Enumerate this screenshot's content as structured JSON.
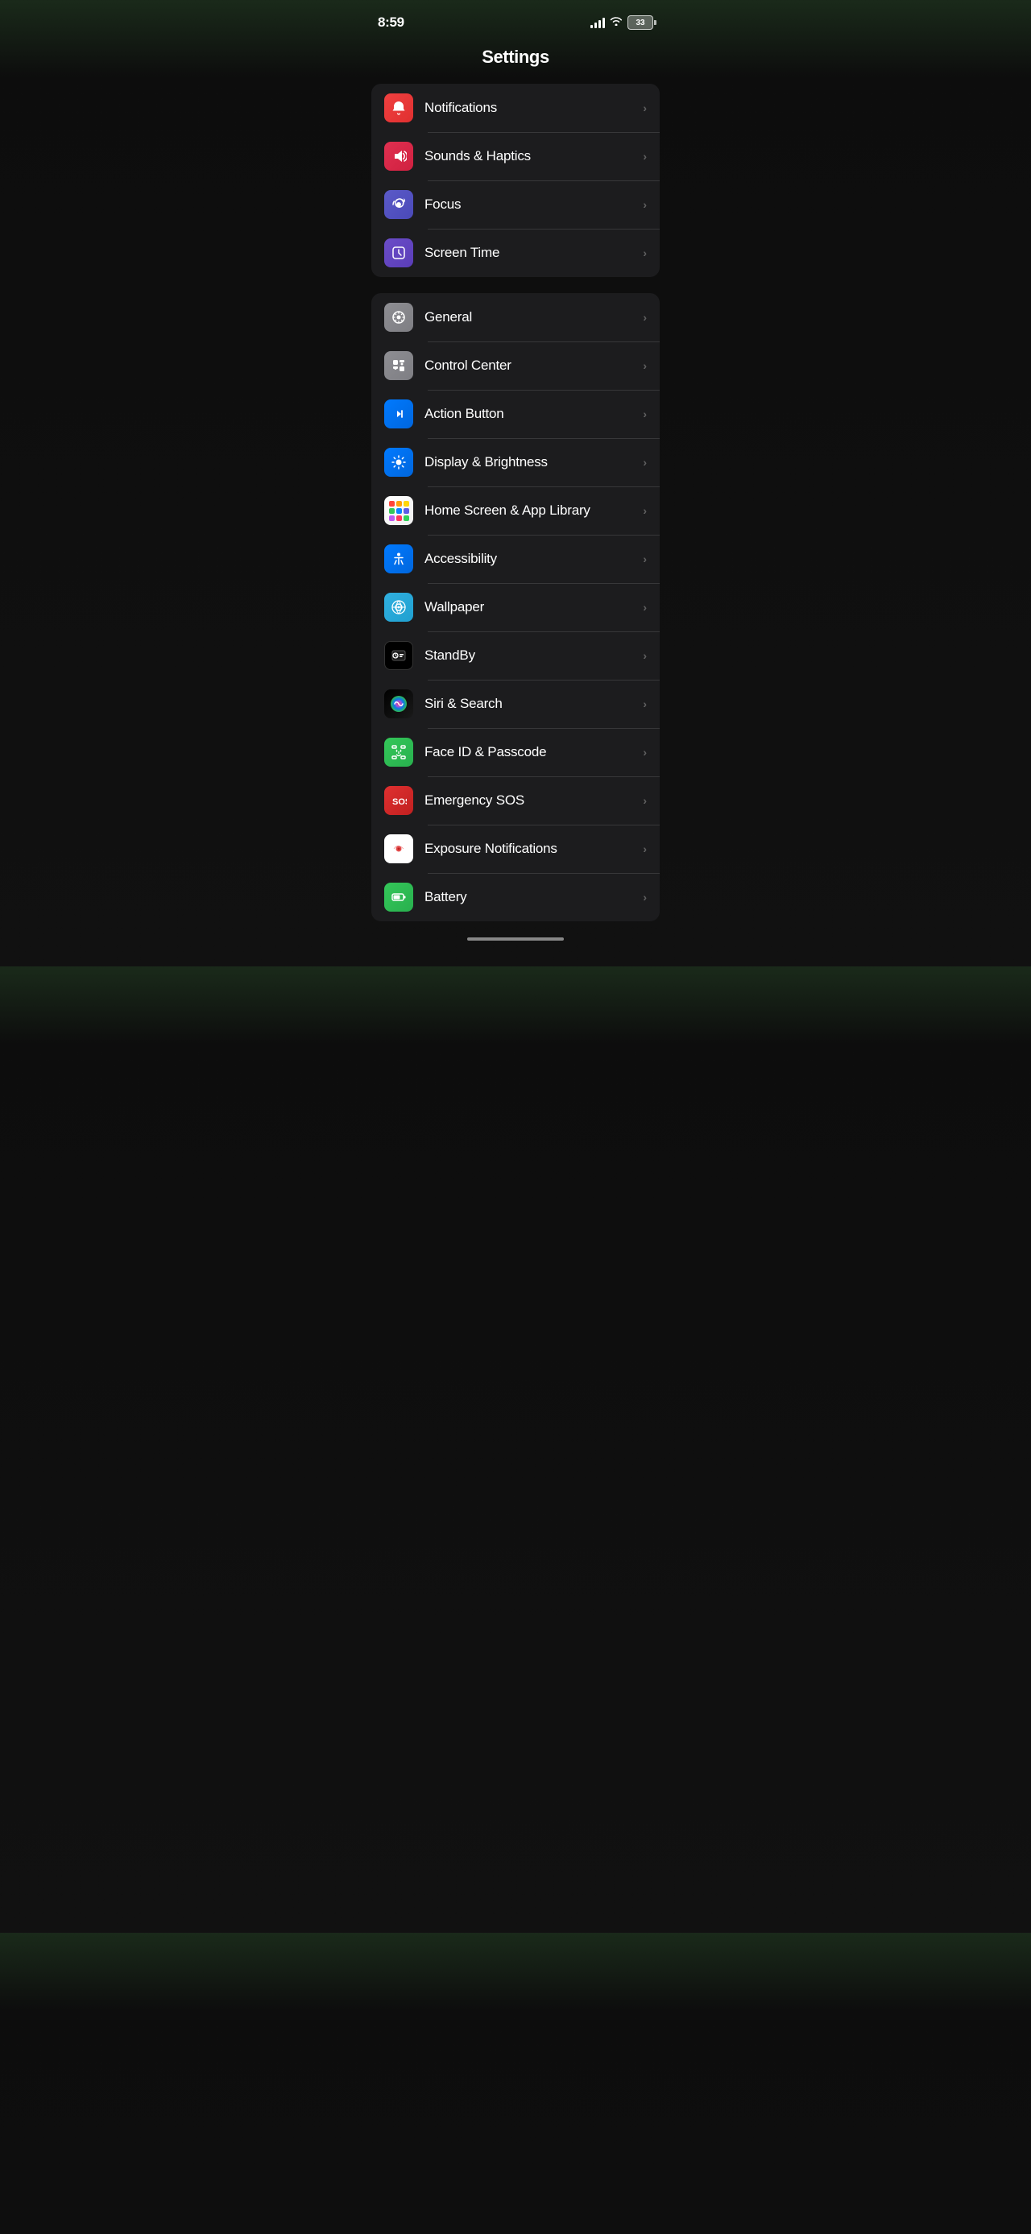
{
  "statusBar": {
    "time": "8:59",
    "battery": "33"
  },
  "title": "Settings",
  "sections": [
    {
      "id": "section1",
      "items": [
        {
          "id": "notifications",
          "label": "Notifications",
          "icon": "notifications"
        },
        {
          "id": "sounds",
          "label": "Sounds & Haptics",
          "icon": "sounds"
        },
        {
          "id": "focus",
          "label": "Focus",
          "icon": "focus"
        },
        {
          "id": "screentime",
          "label": "Screen Time",
          "icon": "screentime"
        }
      ]
    },
    {
      "id": "section2",
      "items": [
        {
          "id": "general",
          "label": "General",
          "icon": "general"
        },
        {
          "id": "controlcenter",
          "label": "Control Center",
          "icon": "controlcenter"
        },
        {
          "id": "actionbutton",
          "label": "Action Button",
          "icon": "actionbutton"
        },
        {
          "id": "displaybrightness",
          "label": "Display & Brightness",
          "icon": "displaybrightness"
        },
        {
          "id": "homescreen",
          "label": "Home Screen & App Library",
          "icon": "homescreen"
        },
        {
          "id": "accessibility",
          "label": "Accessibility",
          "icon": "accessibility"
        },
        {
          "id": "wallpaper",
          "label": "Wallpaper",
          "icon": "wallpaper"
        },
        {
          "id": "standby",
          "label": "StandBy",
          "icon": "standby"
        },
        {
          "id": "siri",
          "label": "Siri & Search",
          "icon": "siri"
        },
        {
          "id": "faceid",
          "label": "Face ID & Passcode",
          "icon": "faceid"
        },
        {
          "id": "emergencysos",
          "label": "Emergency SOS",
          "icon": "emergencysos"
        },
        {
          "id": "exposure",
          "label": "Exposure Notifications",
          "icon": "exposure"
        },
        {
          "id": "battery",
          "label": "Battery",
          "icon": "battery"
        }
      ]
    }
  ],
  "chevron": "›"
}
